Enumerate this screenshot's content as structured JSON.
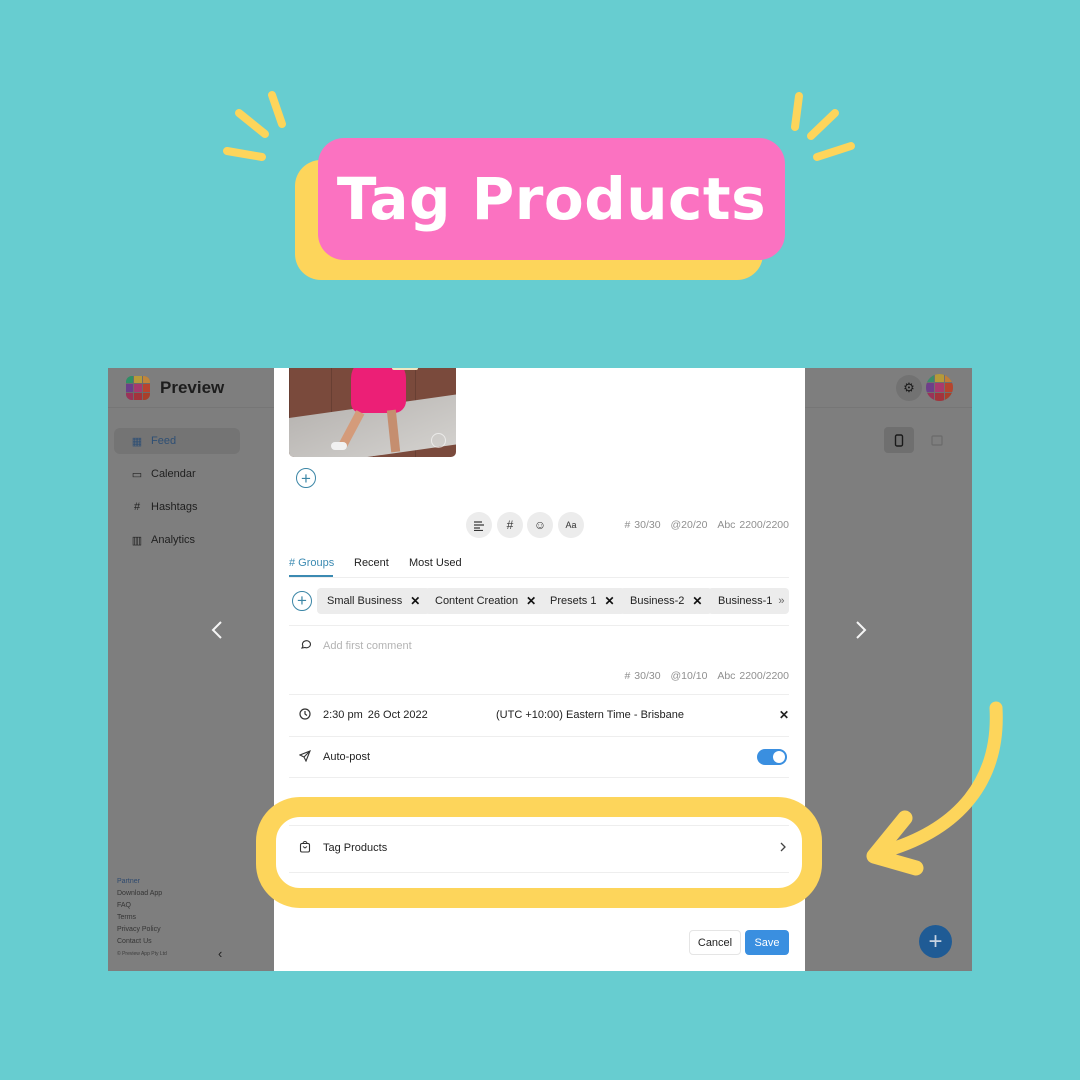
{
  "banner": {
    "title": "Tag Products",
    "colors": {
      "background": "#67cdd0",
      "pill": "#fb72c1",
      "pill_shadow": "#fdd55b",
      "text": "#ffffff"
    }
  },
  "app": {
    "name": "Preview",
    "header": {
      "settings_icon": "gear-icon",
      "avatar_icon": "avatar-grid-icon",
      "view_toggles": [
        {
          "icon": "phone-icon",
          "active": true
        },
        {
          "icon": "calendar-icon",
          "active": false
        }
      ]
    },
    "sidebar": {
      "items": [
        {
          "label": "Feed",
          "icon": "grid-icon",
          "active": true
        },
        {
          "label": "Calendar",
          "icon": "calendar-icon",
          "active": false
        },
        {
          "label": "Hashtags",
          "icon": "hashtag-icon",
          "active": false
        },
        {
          "label": "Analytics",
          "icon": "chart-icon",
          "active": false
        }
      ],
      "footer_links": [
        "Partner",
        "Download App",
        "FAQ",
        "Terms",
        "Privacy Policy",
        "Contact Us"
      ],
      "copyright": "© Preview App Pty Ltd"
    },
    "fab_icon": "plus-icon"
  },
  "modal": {
    "caption_tools": [
      "align-left-icon",
      "hashtag-icon",
      "emoji-icon",
      "font-icon"
    ],
    "font_tool_label": "Aa",
    "caption_counters": {
      "hashtags": "# 30/30",
      "mentions": "@20/20",
      "chars": "Abc 2200/2200"
    },
    "tabs": [
      {
        "label": "# Groups",
        "active": true
      },
      {
        "label": "Recent",
        "active": false
      },
      {
        "label": "Most Used",
        "active": false
      }
    ],
    "hashtag_groups": [
      "Small Business",
      "Content Creation",
      "Presets 1",
      "Business-2",
      "Business-1"
    ],
    "more_label": "»",
    "first_comment": {
      "placeholder": "Add first comment"
    },
    "comment_counters": {
      "hashtags": "# 30/30",
      "mentions": "@10/10",
      "chars": "Abc 2200/2200"
    },
    "schedule": {
      "time": "2:30 pm",
      "date": "26 Oct 2022",
      "timezone": "(UTC +10:00) Eastern Time - Brisbane"
    },
    "auto_post": {
      "label": "Auto-post",
      "enabled": true
    },
    "tag_products": {
      "label": "Tag Products"
    },
    "buttons": {
      "cancel": "Cancel",
      "save": "Save"
    },
    "accent_color": "#3a8fe0"
  },
  "annotation": {
    "highlight_color": "#fdd55b",
    "arrow": "curved-arrow-icon"
  }
}
